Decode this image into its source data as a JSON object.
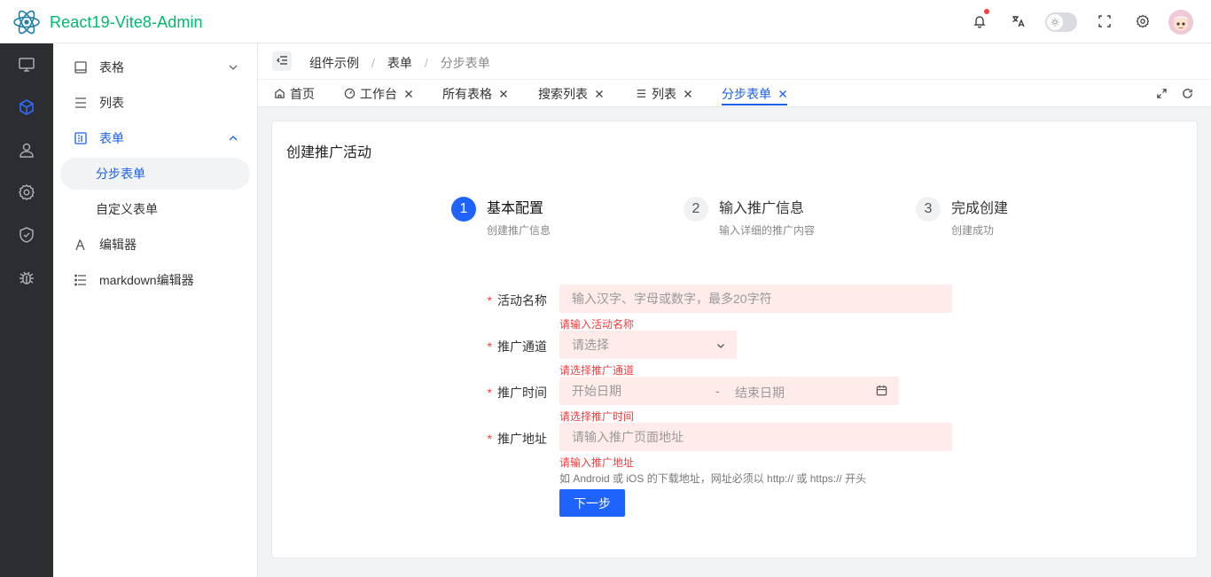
{
  "header": {
    "app_title": "React19-Vite8-Admin",
    "colors": {
      "brand": "#00b96b",
      "accent": "#1f63ff",
      "error": "#f53f3f"
    },
    "icons": [
      "react-logo",
      "bell-icon",
      "translate-icon",
      "theme-toggle",
      "fullscreen-icon",
      "settings-icon",
      "avatar"
    ]
  },
  "rail": {
    "items": [
      "monitor-icon",
      "cube-icon",
      "user-icon",
      "gear-icon",
      "shield-icon",
      "bug-icon"
    ],
    "active": "cube-icon"
  },
  "menu": {
    "items": [
      {
        "label": "表格",
        "icon": "table-icon",
        "expanded": false
      },
      {
        "label": "列表",
        "icon": "list-icon"
      },
      {
        "label": "表单",
        "icon": "form-icon",
        "expanded": true
      },
      {
        "label": "分步表单",
        "child": true,
        "selected": true
      },
      {
        "label": "自定义表单",
        "child": true
      },
      {
        "label": "编辑器",
        "icon": "editor-icon"
      },
      {
        "label": "markdown编辑器",
        "icon": "markdown-icon"
      }
    ]
  },
  "breadcrumb": {
    "items": [
      "组件示例",
      "表单",
      "分步表单"
    ],
    "separator": "/"
  },
  "tabs": [
    {
      "label": "首页",
      "icon": "home-icon",
      "closable": false
    },
    {
      "label": "工作台",
      "icon": "dashboard-icon",
      "closable": true
    },
    {
      "label": "所有表格",
      "closable": true
    },
    {
      "label": "搜索列表",
      "closable": true
    },
    {
      "label": "列表",
      "icon": "list-icon",
      "closable": true
    },
    {
      "label": "分步表单",
      "closable": true,
      "active": true
    }
  ],
  "card": {
    "title": "创建推广活动",
    "steps": [
      {
        "num": "1",
        "title": "基本配置",
        "desc": "创建推广信息",
        "active": true
      },
      {
        "num": "2",
        "title": "输入推广信息",
        "desc": "输入详细的推广内容"
      },
      {
        "num": "3",
        "title": "完成创建",
        "desc": "创建成功"
      }
    ],
    "form": {
      "name": {
        "label": "活动名称",
        "placeholder": "输入汉字、字母或数字，最多20字符",
        "error": "请输入活动名称"
      },
      "channel": {
        "label": "推广通道",
        "placeholder": "请选择",
        "error": "请选择推广通道"
      },
      "time": {
        "label": "推广时间",
        "start_placeholder": "开始日期",
        "separator": "-",
        "end_placeholder": "结束日期",
        "error": "请选择推广时间"
      },
      "url": {
        "label": "推广地址",
        "placeholder": "请输入推广页面地址",
        "error": "请输入推广地址",
        "help": "如 Android 或 iOS 的下载地址，网址必须以 http:// 或 https:// 开头"
      },
      "required_mark": "*",
      "next_label": "下一步"
    }
  }
}
